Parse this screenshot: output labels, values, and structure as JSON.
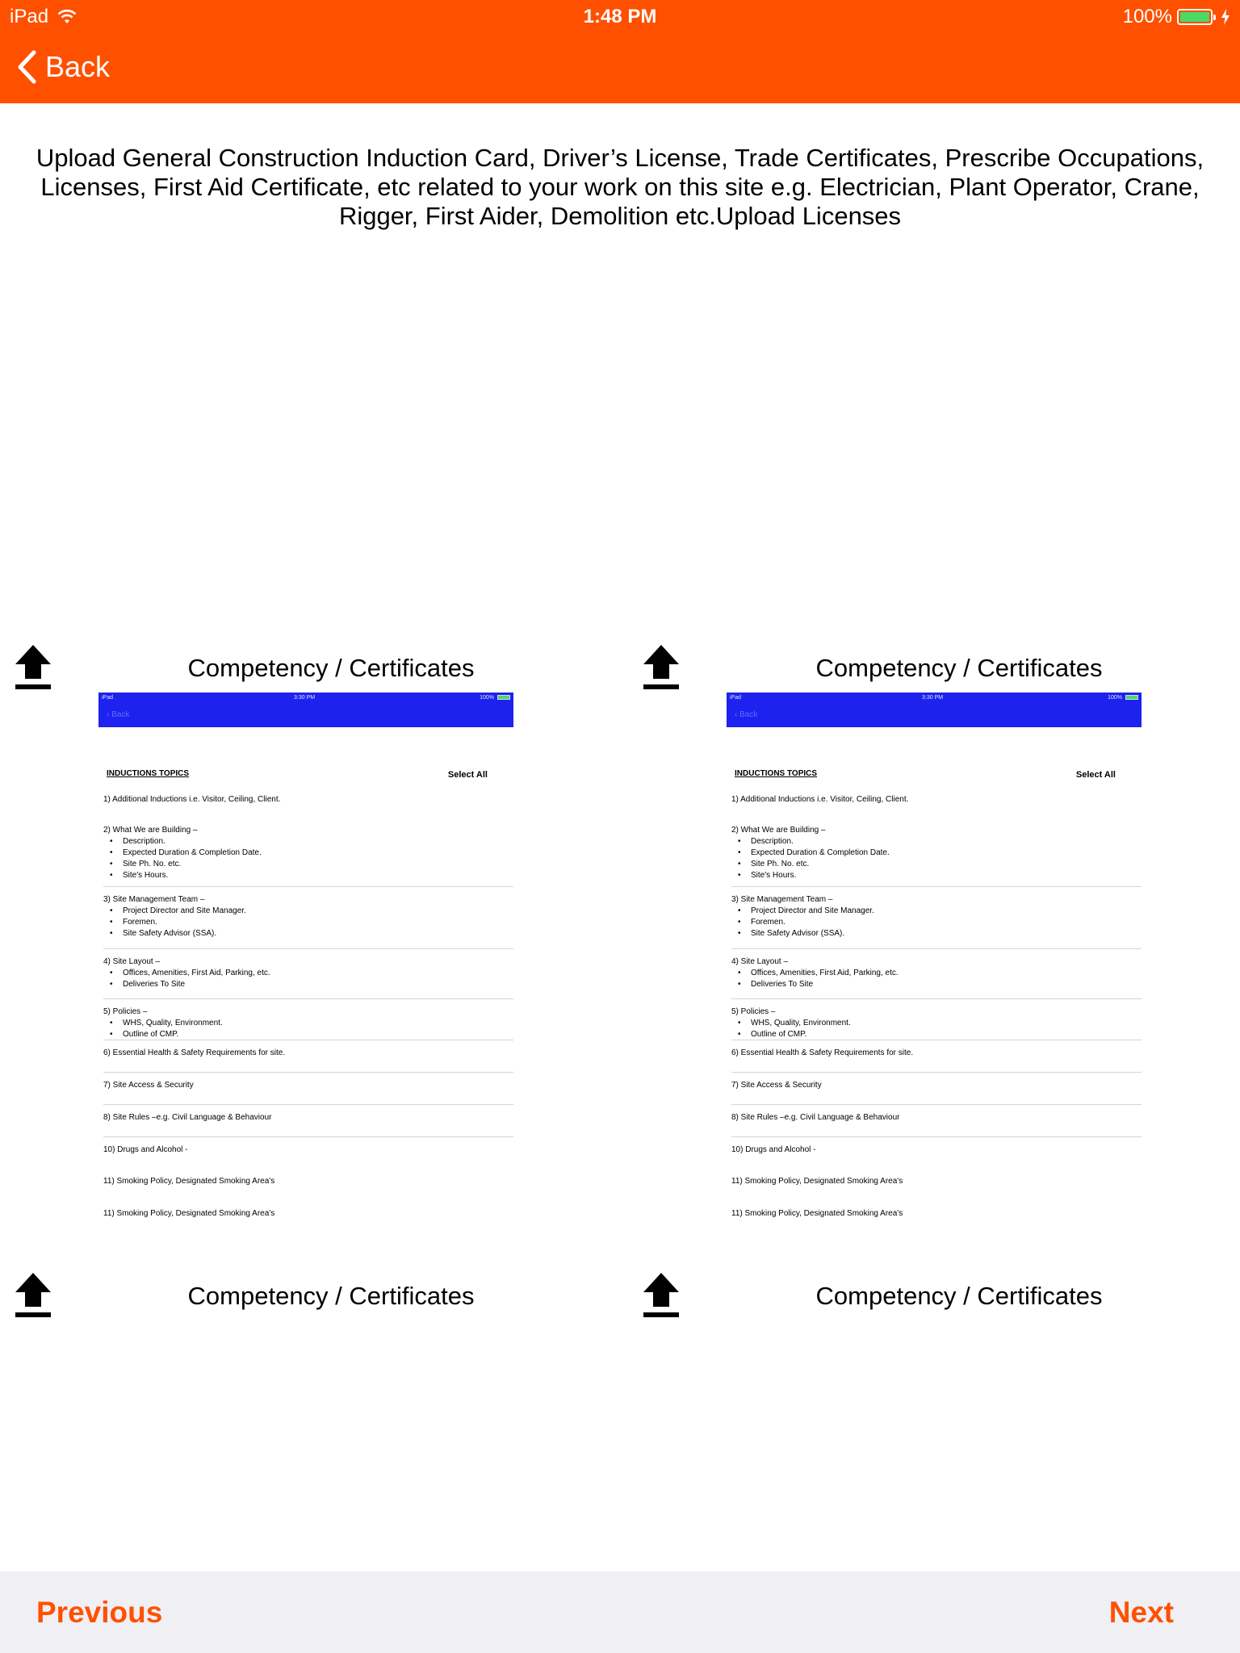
{
  "status_bar": {
    "device": "iPad",
    "time": "1:48 PM",
    "battery": "100%",
    "battery_level": 1.0,
    "icons": [
      "wifi-icon",
      "battery-icon",
      "charging-bolt-icon"
    ]
  },
  "nav": {
    "back_label": "Back",
    "bar_color": "#ff5000"
  },
  "instructions": "Upload General Construction Induction Card, Driver’s License, Trade Certificates, Prescribe Occupations, Licenses, First Aid Certificate, etc related to your work on this site e.g. Electrician, Plant Operator, Crane, Rigger, First Aider, Demolition etc.Upload Licenses",
  "uploads": [
    {
      "title": "Competency / Certificates",
      "icon": "upload-icon"
    },
    {
      "title": "Competency / Certificates",
      "icon": "upload-icon"
    },
    {
      "title": "Competency / Certificates",
      "icon": "upload-icon"
    },
    {
      "title": "Competency / Certificates",
      "icon": "upload-icon"
    }
  ],
  "thumbnail": {
    "device": "iPad",
    "time": "3:30 PM",
    "battery": "100%",
    "back_label": "Back",
    "bar_color": "#1e22ee",
    "header": "INDUCTIONS TOPICS",
    "select_all": "Select All",
    "topics": [
      {
        "title": "1) Additional Inductions i.e. Visitor, Ceiling, Client.",
        "items": []
      },
      {
        "title": "2) What We are Building –",
        "items": [
          "Description.",
          "Expected Duration & Completion Date.",
          "Site Ph. No. etc.",
          "Site's Hours."
        ]
      },
      {
        "title": "3) Site Management Team –",
        "items": [
          "Project Director and Site Manager.",
          "Foremen.",
          "Site Safety Advisor (SSA)."
        ]
      },
      {
        "title": "4) Site Layout –",
        "items": [
          "Offices, Amenities, First Aid, Parking, etc.",
          "Deliveries To Site"
        ]
      },
      {
        "title": "5) Policies –",
        "items": [
          "WHS, Quality, Environment.",
          "Outline of CMP."
        ]
      },
      {
        "title": "6) Essential Health & Safety Requirements for site.",
        "items": []
      },
      {
        "title": "7) Site Access & Security",
        "items": []
      },
      {
        "title": "8) Site Rules –e.g. Civil Language & Behaviour",
        "items": []
      },
      {
        "title": "10) Drugs and Alcohol -",
        "items": []
      },
      {
        "title": "11) Smoking Policy, Designated Smoking Area's",
        "items": []
      },
      {
        "title": "11) Smoking Policy, Designated Smoking Area's",
        "items": []
      }
    ]
  },
  "footer": {
    "previous_label": "Previous",
    "next_label": "Next",
    "accent_color": "#ff5000"
  }
}
